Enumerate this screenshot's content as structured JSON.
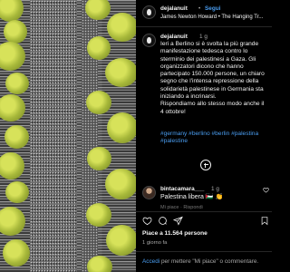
{
  "header": {
    "username": "dejalanuit",
    "separator": "•",
    "follow_label": "Segui",
    "audio": "James Newton Howard • The Hanging Tr..."
  },
  "caption": {
    "username": "dejalanuit",
    "age": "1 g",
    "text_lines": [
      "Ieri a Berlino si è svolta la più grande",
      "manifestazione tedesca contro lo",
      "sterminio dei palestinesi a Gaza. Gli",
      "organizzatori dicono che hanno",
      "partecipato 150.000 persone, un chiaro",
      "segno che l'intensa repressione della",
      "solidarietà palestinese in Germania sta",
      "iniziando a incrinarsi.",
      "Rispondiamo allo stesso modo anche il",
      "4 ottobre!"
    ],
    "hashtags_line1": "#germany #berlino #berlin #palestina",
    "hashtags_line2": "#palestine"
  },
  "comment": {
    "username": "bintacamara___",
    "age": "1 g",
    "text": "Palestina libera 🇵🇸 👏",
    "actions": "Mi piace · Rispondi"
  },
  "engagement": {
    "likes": "Piace a 11.564 persone",
    "date": "1 giorno fa"
  },
  "footer": {
    "login_link": "Accedi",
    "rest": " per mettere \"Mi piace\" o commentare."
  },
  "icons": [
    "verified-badge-icon",
    "add-comment-icon",
    "heart-icon",
    "comment-icon",
    "share-icon",
    "bookmark-icon"
  ],
  "colors": {
    "link": "#4a9df0",
    "background": "#000000",
    "text": "#f5f5f5",
    "muted": "#a8a8a8"
  }
}
